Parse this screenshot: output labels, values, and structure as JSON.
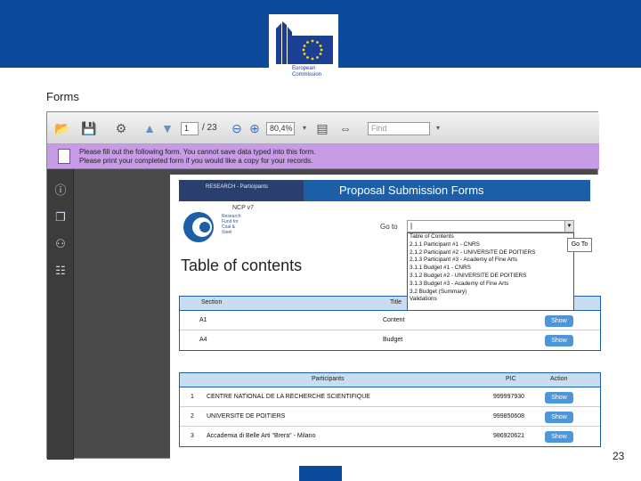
{
  "header": {
    "logo_line1": "European",
    "logo_line2": "Commission"
  },
  "slide": {
    "title": "Forms",
    "page_number": "23"
  },
  "toolbar": {
    "page_current": "1",
    "page_total": "/ 23",
    "zoom": "80,4%",
    "find_placeholder": "Find"
  },
  "notice": {
    "line1": "Please fill out the following form. You cannot save data typed into this form.",
    "line2": "Please print your completed form if you would like a copy for your records."
  },
  "document": {
    "banner_left": "RESEARCH - Participants",
    "banner_title": "Proposal Submission Forms",
    "ncp_label": "NCP v7",
    "logo_text": "Research Fund for Coal & Steel",
    "toc_title": "Table of contents",
    "goto_label": "Go to",
    "goto_value": "|",
    "goto_button": "Go To",
    "dropdown_options": [
      "Table of Contents",
      "2.1.1 Participant #1 - CNRS",
      "2.1.2 Participant #2 - UNIVERSITE DE POITIERS",
      "2.1.3 Participant #3 - Academy of Fine Arts",
      "3.1.1 Budget #1 - CNRS",
      "3.1.2 Budget #2 - UNIVERSITE DE POITIERS",
      "3.1.3 Budget #3 - Academy of Fine Arts",
      "3.2 Budget (Summary)",
      "Validations"
    ],
    "sections_table": {
      "headers": [
        "Section",
        "Title"
      ],
      "rows": [
        {
          "section": "A1",
          "title": "Content",
          "action": "Show"
        },
        {
          "section": "A4",
          "title": "Budget",
          "action": "Show"
        }
      ]
    },
    "participants_table": {
      "headers": [
        "Participants",
        "PIC",
        "Action"
      ],
      "rows": [
        {
          "num": "1",
          "name": "CENTRE NATIONAL DE LA RECHERCHE SCIENTIFIQUE",
          "pic": "999997930",
          "action": "Show"
        },
        {
          "num": "2",
          "name": "UNIVERSITE DE POITIERS",
          "pic": "999850608",
          "action": "Show"
        },
        {
          "num": "3",
          "name": "Accademia di Belle Arti \"Brera\" - Milano",
          "pic": "986920621",
          "action": "Show"
        }
      ]
    }
  }
}
